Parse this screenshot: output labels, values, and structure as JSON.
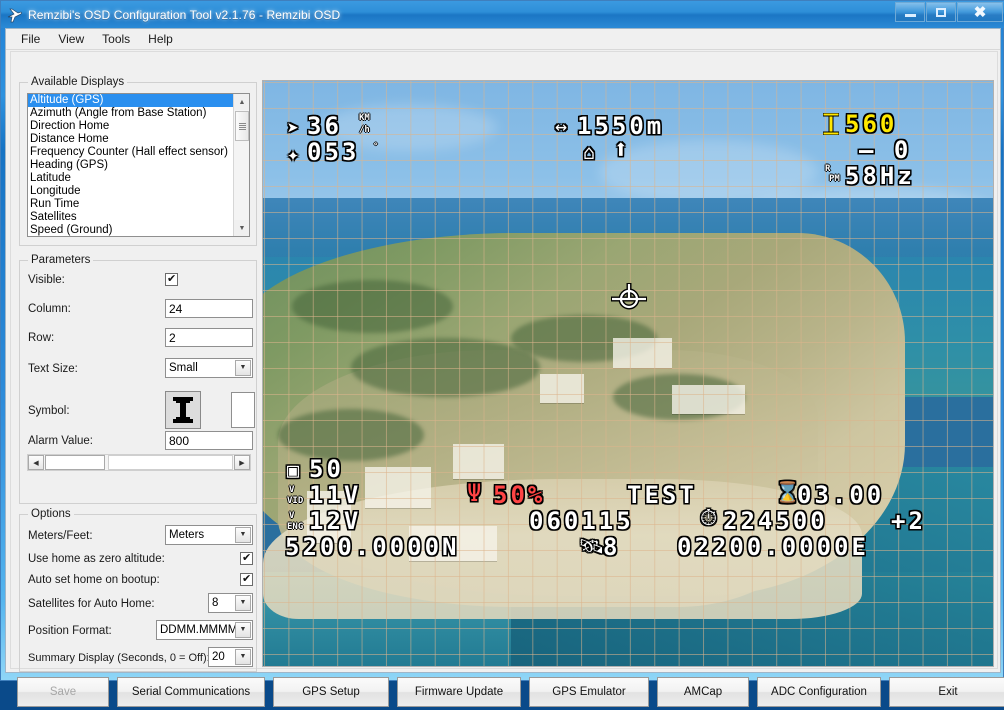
{
  "window": {
    "title": "Remzibi's OSD Configuration Tool v2.1.76 - Remzibi OSD",
    "app_icon": "plane-icon",
    "minimize_label": "–",
    "maximize_label": "□",
    "close_label": "✕"
  },
  "menu": {
    "items": [
      "File",
      "View",
      "Tools",
      "Help"
    ]
  },
  "displays": {
    "group_title": "Available Displays",
    "items": [
      "Altitude (GPS)",
      "Azimuth (Angle from Base Station)",
      "Direction Home",
      "Distance Home",
      "Frequency Counter (Hall effect sensor)",
      "Heading (GPS)",
      "Latitude",
      "Longitude",
      "Run Time",
      "Satellites",
      "Speed (Ground)"
    ],
    "selected_index": 0,
    "scroll_up_glyph": "▲",
    "scroll_down_glyph": "▼"
  },
  "parameters": {
    "group_title": "Parameters",
    "visible_label": "Visible:",
    "visible_checked": true,
    "column_label": "Column:",
    "column_value": "24",
    "row_label": "Row:",
    "row_value": "2",
    "text_size_label": "Text Size:",
    "text_size_value": "Small",
    "symbol_label": "Symbol:",
    "symbol_glyph": "altitude-symbol",
    "alarm_label": "Alarm Value:",
    "alarm_value": "800",
    "scroll_left_glyph": "◀",
    "scroll_right_glyph": "▶"
  },
  "options": {
    "group_title": "Options",
    "meters_feet_label": "Meters/Feet:",
    "meters_feet_value": "Meters",
    "home_zero_label": "Use home as zero altitude:",
    "home_zero_checked": true,
    "auto_home_label": "Auto set home on bootup:",
    "auto_home_checked": true,
    "sats_home_label": "Satellites for Auto Home:",
    "sats_home_value": "8",
    "position_format_label": "Position Format:",
    "position_format_value": "DDMM.MMMM",
    "summary_label": "Summary Display (Seconds, 0 = Off):",
    "summary_value": "20",
    "dropdown_glyph": "▼"
  },
  "buttons": [
    {
      "label": "Save",
      "disabled": true
    },
    {
      "label": "Serial Communications",
      "disabled": false
    },
    {
      "label": "GPS Setup",
      "disabled": false
    },
    {
      "label": "Firmware Update",
      "disabled": false
    },
    {
      "label": "GPS Emulator",
      "disabled": false
    },
    {
      "label": "AMCap",
      "disabled": false
    },
    {
      "label": "ADC Configuration",
      "disabled": false
    },
    {
      "label": "Exit",
      "disabled": false
    }
  ],
  "osd": {
    "speed": "36",
    "speed_unit": "KM",
    "speed_unit2": "/h",
    "speed_icon": "speed-arrow-icon",
    "heading": "053",
    "heading_unit": "°",
    "heading_icon": "compass-icon",
    "distance": "1550m",
    "distance_icon": "distance-span-icon",
    "home_icon": "home-icon",
    "direction_home_icon": "direction-home-arrow-icon",
    "altitude": "560",
    "altitude_icon": "altitude-symbol-icon",
    "altitude_color": "#ffe800",
    "azimuth": "– 0",
    "rpm": "58Hz",
    "rpm_label": "RPM",
    "battery": "50",
    "battery_icon": "battery-icon",
    "v_vid": "11V",
    "v_vid_label": "V VID",
    "v_eng": "12V",
    "v_eng_label": "V ENG",
    "rssi": "50%",
    "rssi_icon": "antenna-icon",
    "rssi_color": "#ff4444",
    "callsign": "TEST",
    "runtime": "03.00",
    "runtime_icon": "hourglass-icon",
    "date": "060115",
    "clock_icon": "clock-icon",
    "time": "224500",
    "tz": "+2",
    "latitude": "5200.0000N",
    "satellites": "8",
    "satellite_icon": "satellite-icon",
    "longitude": "02200.0000E",
    "center_icon": "aircraft-crosshair-icon"
  }
}
